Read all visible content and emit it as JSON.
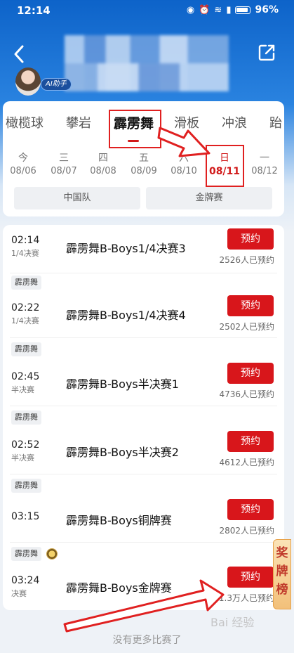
{
  "status_bar": {
    "time": "12:14",
    "battery": "96%"
  },
  "header": {
    "ai_badge": "AI助手"
  },
  "sport_tabs": [
    {
      "label": "橄榄球"
    },
    {
      "label": "攀岩"
    },
    {
      "label": "霹雳舞",
      "active": true
    },
    {
      "label": "滑板"
    },
    {
      "label": "冲浪"
    },
    {
      "label": "跆"
    }
  ],
  "dates": [
    {
      "dow": "今",
      "date": "08/06"
    },
    {
      "dow": "三",
      "date": "08/07"
    },
    {
      "dow": "四",
      "date": "08/08"
    },
    {
      "dow": "五",
      "date": "08/09"
    },
    {
      "dow": "六",
      "date": "08/10"
    },
    {
      "dow": "日",
      "date": "08/11",
      "active": true
    },
    {
      "dow": "一",
      "date": "08/12"
    }
  ],
  "filters": [
    "中国队",
    "金牌赛"
  ],
  "events": [
    {
      "tag": "",
      "time": "02:14",
      "stage": "1/4决赛",
      "name": "霹雳舞B-Boys1/4决赛3",
      "button": "预约",
      "booked": "2526人已预约"
    },
    {
      "tag": "霹雳舞",
      "time": "02:22",
      "stage": "1/4决赛",
      "name": "霹雳舞B-Boys1/4决赛4",
      "button": "预约",
      "booked": "2502人已预约"
    },
    {
      "tag": "霹雳舞",
      "time": "02:45",
      "stage": "半决赛",
      "name": "霹雳舞B-Boys半决赛1",
      "button": "预约",
      "booked": "4736人已预约"
    },
    {
      "tag": "霹雳舞",
      "time": "02:52",
      "stage": "半决赛",
      "name": "霹雳舞B-Boys半决赛2",
      "button": "预约",
      "booked": "4612人已预约"
    },
    {
      "tag": "霹雳舞",
      "time": "03:15",
      "stage": "",
      "name": "霹雳舞B-Boys铜牌赛",
      "button": "预约",
      "booked": "2802人已预约"
    },
    {
      "tag": "霹雳舞",
      "time": "03:24",
      "stage": "决赛",
      "name": "霹雳舞B-Boys金牌赛",
      "button": "预约",
      "booked": "1.3万人已预约"
    }
  ],
  "award_tab": "奖牌榜",
  "footer": "没有更多比赛了",
  "watermark": "Bai 经验",
  "colors": {
    "primary_blue": "#0d63c9",
    "accent_red": "#d8161b"
  },
  "icons": {
    "back": "chevron-left-icon",
    "share": "share-icon",
    "medal": "medal-icon"
  }
}
